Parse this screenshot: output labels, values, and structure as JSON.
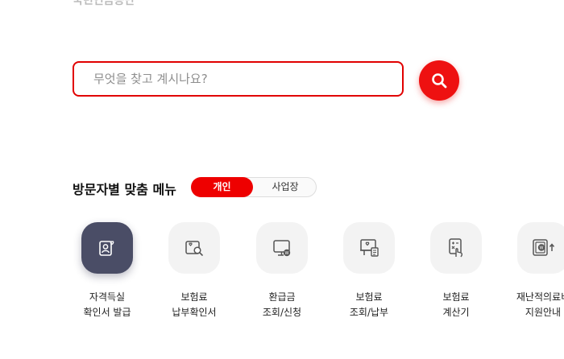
{
  "header": {
    "partial_title": "국민연금공단"
  },
  "search": {
    "placeholder": "무엇을 찾고 계시나요?"
  },
  "menu": {
    "title": "방문자별 맞춤 메뉴",
    "toggle": {
      "active": "개인",
      "inactive": "사업장"
    },
    "items": [
      {
        "label": "자격득실\n확인서 발급",
        "icon": "certificate-person-icon"
      },
      {
        "label": "보험료\n납부확인서",
        "icon": "document-search-icon"
      },
      {
        "label": "환급금\n조회/신청",
        "icon": "monitor-refund-icon"
      },
      {
        "label": "보험료\n조회/납부",
        "icon": "receipt-payment-icon"
      },
      {
        "label": "보험료\n계산기",
        "icon": "calculator-hand-icon"
      },
      {
        "label": "재난적의료비\n지원안내",
        "icon": "support-money-icon"
      }
    ]
  },
  "colors": {
    "accent": "#ee0000",
    "dark_icon_bg": "#4a4d66",
    "icon_bg": "#f3f3f3"
  }
}
